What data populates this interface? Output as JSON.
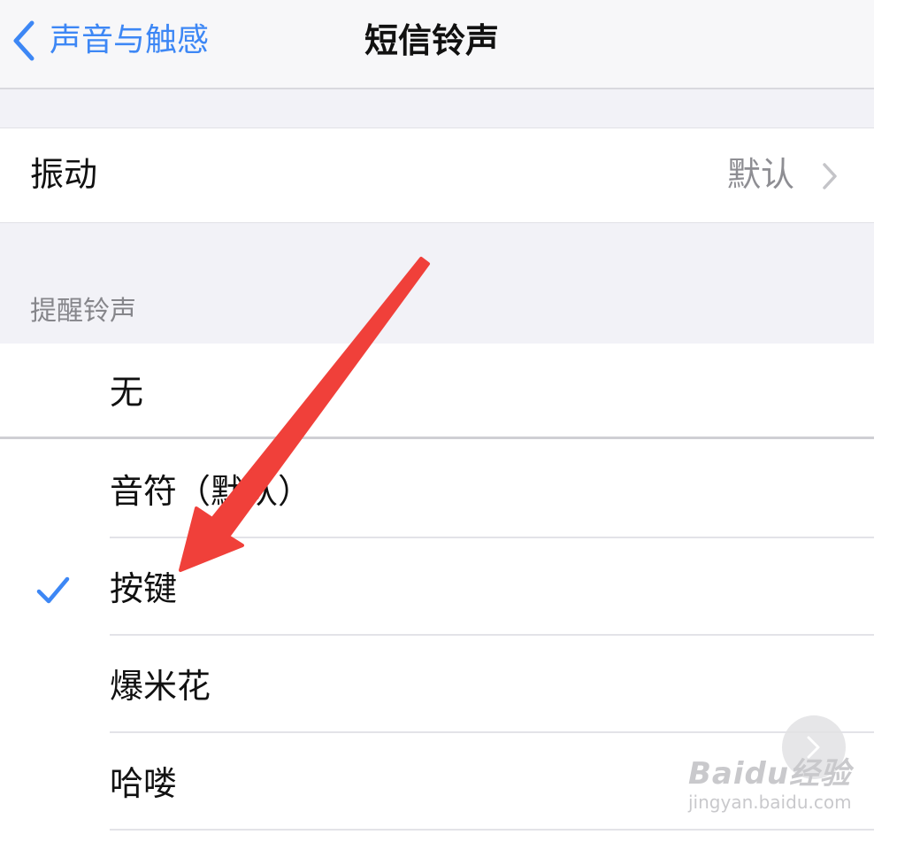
{
  "nav": {
    "back_label": "声音与触感",
    "title": "短信铃声"
  },
  "vibration": {
    "label": "振动",
    "value": "默认"
  },
  "alert_section": {
    "header": "提醒铃声",
    "items": [
      {
        "label": "无",
        "selected": false
      },
      {
        "label": "音符（默认）",
        "selected": false
      },
      {
        "label": "按键",
        "selected": true
      },
      {
        "label": "爆米花",
        "selected": false
      },
      {
        "label": "哈喽",
        "selected": false
      }
    ]
  },
  "watermark": {
    "brand": "Baidu经验",
    "url": "jingyan.baidu.com"
  },
  "colors": {
    "accent": "#3d87f5",
    "annotation_arrow": "#f0403a",
    "secondary_text": "#8e8e93"
  },
  "icons": [
    "chevron-left-icon",
    "chevron-right-icon",
    "checkmark-icon",
    "arrow-annotation",
    "next-page-icon"
  ]
}
